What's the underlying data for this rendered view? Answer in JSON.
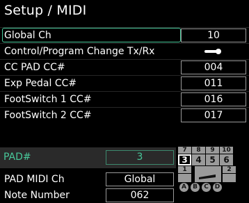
{
  "screen": {
    "title": "Setup / MIDI"
  },
  "settings": [
    {
      "label": "Global Ch",
      "value": "10",
      "selected": true
    },
    {
      "label": "Control/Program Change Tx/Rx",
      "toggle": "on"
    },
    {
      "label": "CC PAD CC#",
      "value": "004"
    },
    {
      "label": "Exp Pedal CC#",
      "value": "011"
    },
    {
      "label": "FootSwitch 1 CC#",
      "value": "016"
    },
    {
      "label": "FootSwitch 2 CC#",
      "value": "017"
    }
  ],
  "pad": {
    "label": "PAD#",
    "value": "3"
  },
  "pad_settings": [
    {
      "label": "PAD MIDI Ch",
      "value": "Global"
    },
    {
      "label": "Note Number",
      "value": "062"
    }
  ],
  "pad_grid": {
    "top_numbers": [
      "7",
      "8",
      "9",
      "10"
    ],
    "bottom_numbers": [
      "3",
      "4",
      "5",
      "6"
    ],
    "row3_left": "1",
    "row3_right": "2",
    "selected": "3",
    "letters": [
      "A",
      "B",
      "C",
      "D"
    ]
  },
  "colors": {
    "accent": "#48c89a",
    "panel": "#2a2a2a",
    "cell": "#9a9a9a"
  }
}
